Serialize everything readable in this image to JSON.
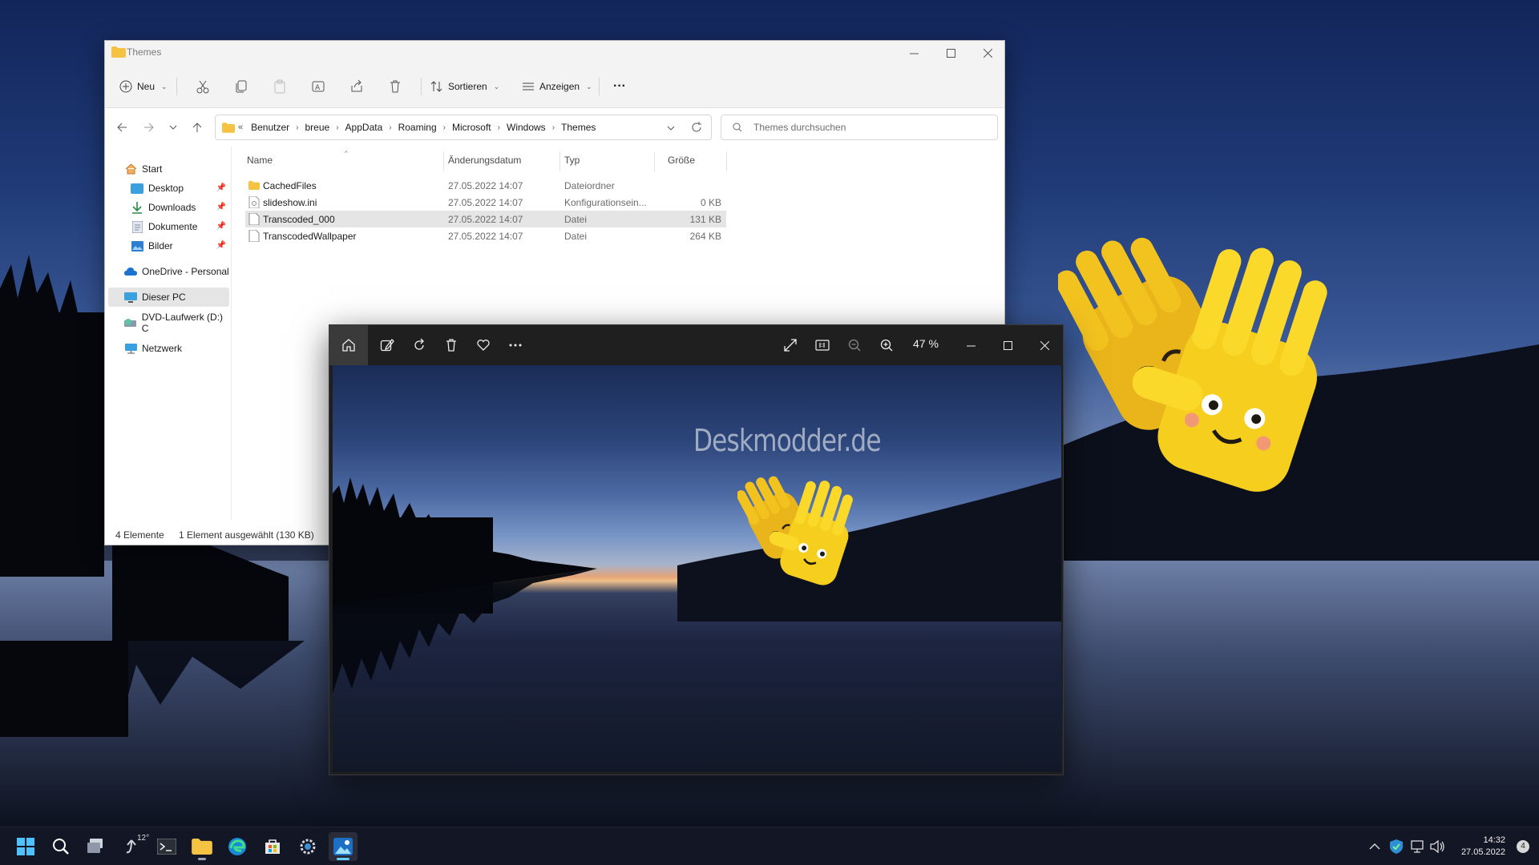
{
  "explorer": {
    "title": "Themes",
    "commands": {
      "new": "Neu",
      "sort": "Sortieren",
      "view": "Anzeigen",
      "more": "···"
    },
    "breadcrumb": {
      "lead": "«",
      "items": [
        "Benutzer",
        "breue",
        "AppData",
        "Roaming",
        "Microsoft",
        "Windows",
        "Themes"
      ]
    },
    "search_placeholder": "Themes durchsuchen",
    "nav": {
      "start": "Start",
      "desktop": "Desktop",
      "downloads": "Downloads",
      "documents": "Dokumente",
      "pictures": "Bilder",
      "onedrive": "OneDrive - Personal",
      "this_pc": "Dieser PC",
      "dvd": "DVD-Laufwerk (D:) C",
      "network": "Netzwerk"
    },
    "columns": {
      "name": "Name",
      "date": "Änderungsdatum",
      "type": "Typ",
      "size": "Größe"
    },
    "files": [
      {
        "name": "CachedFiles",
        "date": "27.05.2022 14:07",
        "type": "Dateiordner",
        "size": "",
        "icon": "folder-icon"
      },
      {
        "name": "slideshow.ini",
        "date": "27.05.2022 14:07",
        "type": "Konfigurationsein...",
        "size": "0 KB",
        "icon": "settings-file-icon"
      },
      {
        "name": "Transcoded_000",
        "date": "27.05.2022 14:07",
        "type": "Datei",
        "size": "131 KB",
        "icon": "file-icon",
        "selected": true
      },
      {
        "name": "TranscodedWallpaper",
        "date": "27.05.2022 14:07",
        "type": "Datei",
        "size": "264 KB",
        "icon": "file-icon"
      }
    ],
    "status": {
      "count": "4 Elemente",
      "selection": "1 Element ausgewählt (130 KB)"
    }
  },
  "photos": {
    "zoom_label": "47 %",
    "watermark": "Deskmodder.de"
  },
  "taskbar": {
    "weather_temp": "12°",
    "time": "14:32",
    "date": "27.05.2022",
    "notification_count": "4",
    "accent": "#60cdff"
  }
}
